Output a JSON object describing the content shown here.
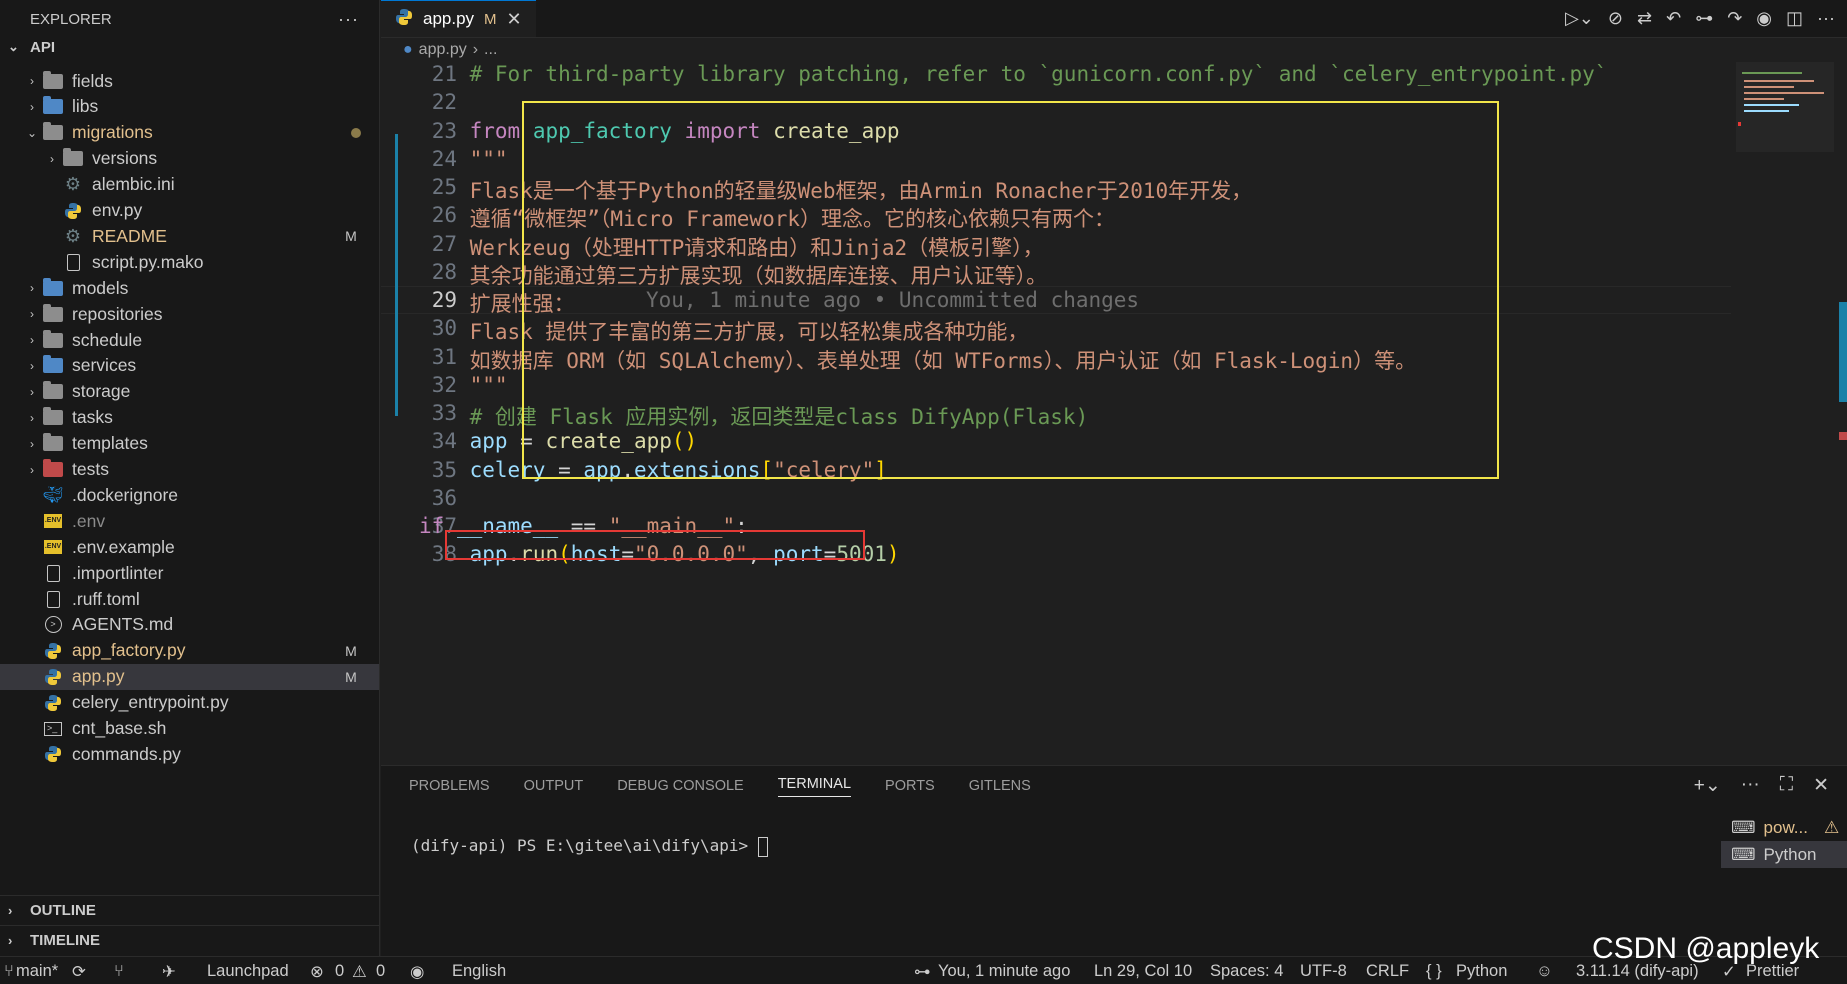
{
  "sidebar": {
    "title": "EXPLORER",
    "more": "···",
    "section": "API",
    "items": [
      {
        "label": "fields",
        "type": "folder",
        "color": "gray",
        "tw": "›",
        "badge": ""
      },
      {
        "label": "libs",
        "type": "folder",
        "color": "blue",
        "tw": "›",
        "badge": ""
      },
      {
        "label": "migrations",
        "type": "folder",
        "color": "gray",
        "tw": "⌄",
        "badge": "dot",
        "mod": true
      },
      {
        "label": "versions",
        "type": "folder",
        "color": "gray",
        "tw": "›",
        "badge": "",
        "indent": 1
      },
      {
        "label": "alembic.ini",
        "type": "gear",
        "tw": "",
        "badge": "",
        "indent": 1
      },
      {
        "label": "env.py",
        "type": "py",
        "tw": "",
        "badge": "",
        "indent": 1
      },
      {
        "label": "README",
        "type": "gear",
        "tw": "",
        "badge": "M",
        "indent": 1,
        "mod": true
      },
      {
        "label": "script.py.mako",
        "type": "file",
        "tw": "",
        "badge": "",
        "indent": 1
      },
      {
        "label": "models",
        "type": "folder",
        "color": "blue",
        "tw": "›",
        "badge": ""
      },
      {
        "label": "repositories",
        "type": "folder",
        "color": "gray",
        "tw": "›",
        "badge": ""
      },
      {
        "label": "schedule",
        "type": "folder",
        "color": "gray",
        "tw": "›",
        "badge": ""
      },
      {
        "label": "services",
        "type": "folder",
        "color": "blue",
        "tw": "›",
        "badge": ""
      },
      {
        "label": "storage",
        "type": "folder",
        "color": "gray",
        "tw": "›",
        "badge": ""
      },
      {
        "label": "tasks",
        "type": "folder",
        "color": "gray",
        "tw": "›",
        "badge": ""
      },
      {
        "label": "templates",
        "type": "folder",
        "color": "gray",
        "tw": "›",
        "badge": ""
      },
      {
        "label": "tests",
        "type": "folder",
        "color": "red",
        "tw": "›",
        "badge": ""
      },
      {
        "label": ".dockerignore",
        "type": "docker",
        "tw": "",
        "badge": ""
      },
      {
        "label": ".env",
        "type": "env",
        "tw": "",
        "badge": "",
        "dim": true
      },
      {
        "label": ".env.example",
        "type": "env",
        "tw": "",
        "badge": ""
      },
      {
        "label": ".importlinter",
        "type": "file",
        "tw": "",
        "badge": ""
      },
      {
        "label": ".ruff.toml",
        "type": "file",
        "tw": "",
        "badge": ""
      },
      {
        "label": "AGENTS.md",
        "type": "md",
        "tw": "",
        "badge": ""
      },
      {
        "label": "app_factory.py",
        "type": "py",
        "tw": "",
        "badge": "M",
        "mod": true
      },
      {
        "label": "app.py",
        "type": "py",
        "tw": "",
        "badge": "M",
        "mod": true,
        "selected": true
      },
      {
        "label": "celery_entrypoint.py",
        "type": "py",
        "tw": "",
        "badge": ""
      },
      {
        "label": "cnt_base.sh",
        "type": "sh",
        "tw": "",
        "badge": ""
      },
      {
        "label": "commands.py",
        "type": "py",
        "tw": "",
        "badge": ""
      }
    ],
    "outline": "OUTLINE",
    "timeline": "TIMELINE"
  },
  "editor": {
    "tab": {
      "label": "app.py",
      "badge": "M",
      "close": "✕"
    },
    "breadcrumb": {
      "file": "app.py",
      "sep": "›",
      "rest": "..."
    },
    "lines": [
      {
        "n": "21",
        "html": "<span class=\"cm\">    # For third-party library patching, refer to `gunicorn.conf.py` and `celery_entrypoint.py`</span>"
      },
      {
        "n": "22",
        "html": ""
      },
      {
        "n": "23",
        "html": "    <span class=\"kw\">from</span> <span class=\"mdl\">app_factory</span> <span class=\"kw\">import</span> <span class=\"fn\">create_app</span>"
      },
      {
        "n": "24",
        "html": "<span class=\"str\">    \"\"\"</span>"
      },
      {
        "n": "25",
        "html": "<span class=\"str\">    Flask是一个基于Python的轻量级Web框架，由Armin Ronacher于2010年开发，</span>"
      },
      {
        "n": "26",
        "html": "<span class=\"str\">    遵循“微框架”（Micro Framework）理念。它的核心依赖只有两个：</span>"
      },
      {
        "n": "27",
        "html": "<span class=\"str\">    Werkzeug（处理HTTP请求和路由）和Jinja2（模板引擎），</span>"
      },
      {
        "n": "28",
        "html": "<span class=\"str\">    其余功能通过第三方扩展实现（如数据库连接、用户认证等）。</span>"
      },
      {
        "n": "29",
        "html": "<span class=\"str\">    扩展性强：</span>",
        "cur": true
      },
      {
        "n": "30",
        "html": "<span class=\"str\">    Flask 提供了丰富的第三方扩展，可以轻松集成各种功能，</span>"
      },
      {
        "n": "31",
        "html": "<span class=\"str\">    如数据库 ORM（如 SQLAlchemy）、表单处理（如 WTForms）、用户认证（如 Flask-Login）等。</span>"
      },
      {
        "n": "32",
        "html": "<span class=\"str\">    \"\"\"</span>"
      },
      {
        "n": "33",
        "html": "<span class=\"cm\">    # 创建 Flask 应用实例，返回类型是class DifyApp(Flask)</span>"
      },
      {
        "n": "34",
        "html": "    <span class=\"vr\">app</span> = <span class=\"fn\">create_app</span><span class=\"br\">()</span>"
      },
      {
        "n": "35",
        "html": "    <span class=\"vr\">celery</span> = <span class=\"vr\">app</span>.<span class=\"vr\">extensions</span><span class=\"br\">[</span><span class=\"str\">\"celery\"</span><span class=\"br\">]</span>"
      },
      {
        "n": "36",
        "html": ""
      },
      {
        "n": "37",
        "html": "<span class=\"kw\">if</span> <span class=\"vr\">__name__</span> == <span class=\"str\">\"__main__\"</span>:"
      },
      {
        "n": "38",
        "html": "    <span class=\"vr\">app</span>.<span class=\"fn\">run</span><span class=\"br\">(</span><span class=\"vr\">host</span>=<span class=\"str\">\"0.0.0.0\"</span>, <span class=\"vr\">port</span>=<span class=\"num\">5001</span><span class=\"br\">)</span>"
      }
    ],
    "blame": "You, 1 minute ago • Uncommitted changes"
  },
  "panel": {
    "tabs": [
      "PROBLEMS",
      "OUTPUT",
      "DEBUG CONSOLE",
      "TERMINAL",
      "PORTS",
      "GITLENS"
    ],
    "active_tab": "TERMINAL",
    "prompt": "(dify-api) PS E:\\gitee\\ai\\dify\\api> ",
    "terminals": [
      "pow...",
      "Python"
    ]
  },
  "status": {
    "branch": "main*",
    "launchpad": "Launchpad",
    "errors": "0",
    "warnings": "0",
    "language_input": "English",
    "blame": "You, 1 minute ago",
    "position": "Ln 29, Col 10",
    "spaces": "Spaces: 4",
    "encoding": "UTF-8",
    "eol": "CRLF",
    "language": "Python",
    "interpreter": "3.11.14 (dify-api)",
    "prettier": "Prettier"
  },
  "watermark": "CSDN @appleyk",
  "colors": {
    "accent": "#0078d4",
    "highlight_box": "#f2e64a",
    "error_box": "#e53935",
    "modified": "#e2c08d"
  }
}
